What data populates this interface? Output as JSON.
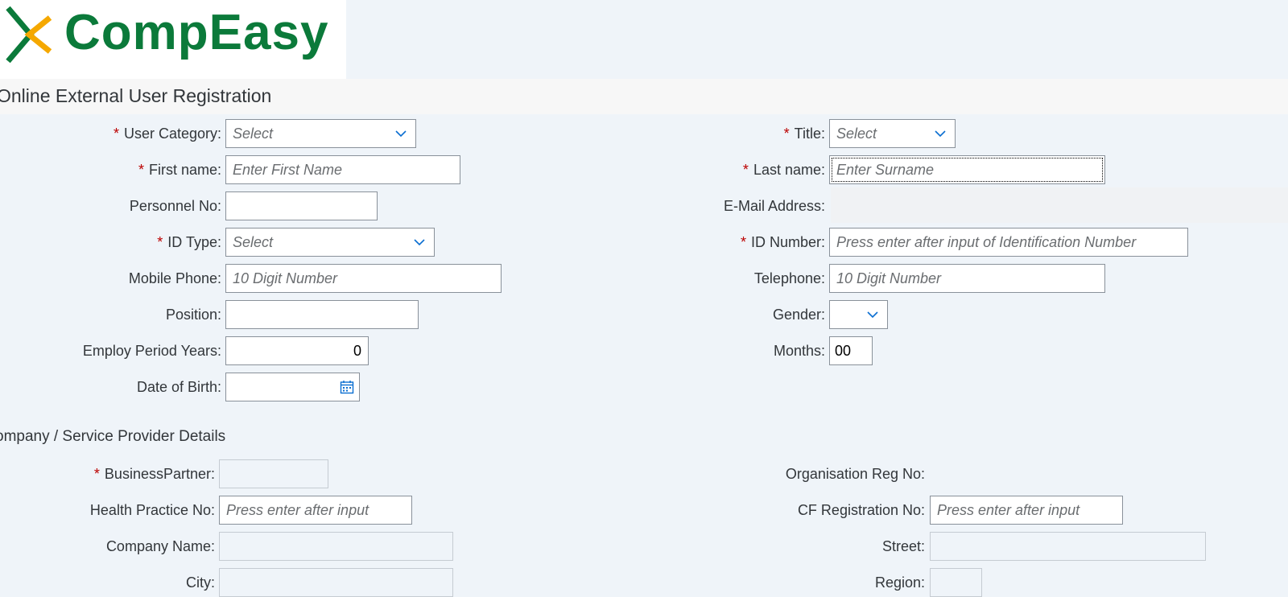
{
  "brand": {
    "name": "CompEasy"
  },
  "page": {
    "title": "Online External User Registration"
  },
  "personal": {
    "user_category": {
      "label": "User Category:",
      "placeholder": "Select"
    },
    "title": {
      "label": "Title:",
      "placeholder": "Select"
    },
    "first_name": {
      "label": "First name:",
      "placeholder": "Enter First Name"
    },
    "last_name": {
      "label": "Last name:",
      "placeholder": "Enter Surname"
    },
    "personnel_no": {
      "label": "Personnel No:",
      "value": ""
    },
    "email": {
      "label": "E-Mail Address:",
      "value": ""
    },
    "id_type": {
      "label": "ID Type:",
      "placeholder": "Select"
    },
    "id_number": {
      "label": "ID Number:",
      "placeholder": "Press enter after input of Identification Number"
    },
    "mobile_phone": {
      "label": "Mobile Phone:",
      "placeholder": "10 Digit Number"
    },
    "telephone": {
      "label": "Telephone:",
      "placeholder": "10 Digit Number"
    },
    "position": {
      "label": "Position:",
      "value": ""
    },
    "gender": {
      "label": "Gender:",
      "value": ""
    },
    "employ_years": {
      "label": "Employ Period Years:",
      "value": "0"
    },
    "months": {
      "label": "Months:",
      "value": "00"
    },
    "dob": {
      "label": "Date of Birth:",
      "value": ""
    }
  },
  "company": {
    "title": "ompany / Service Provider Details",
    "business_partner": {
      "label": "BusinessPartner:",
      "value": ""
    },
    "org_reg_no": {
      "label": "Organisation Reg No:",
      "value": ""
    },
    "health_practice_no": {
      "label": "Health Practice No:",
      "placeholder": "Press enter after input"
    },
    "cf_registration_no": {
      "label": "CF Registration No:",
      "placeholder": "Press enter after input"
    },
    "company_name": {
      "label": "Company Name:",
      "value": ""
    },
    "street": {
      "label": "Street:",
      "value": ""
    },
    "city": {
      "label": "City:",
      "value": ""
    },
    "region": {
      "label": "Region:",
      "value": ""
    }
  },
  "required_marker": "*",
  "colors": {
    "brand_green": "#0b7a3a",
    "brand_orange": "#f5a800",
    "required": "#bb0000",
    "background": "#eff4f9"
  }
}
